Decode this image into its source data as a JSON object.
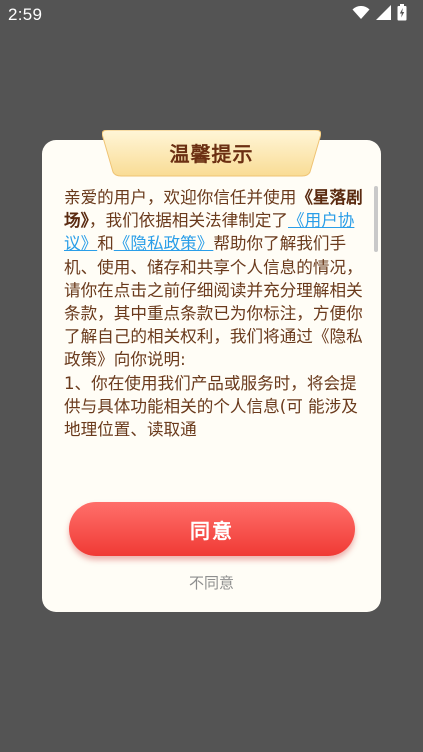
{
  "status_bar": {
    "time": "2:59"
  },
  "dialog": {
    "title": "温馨提示",
    "body": {
      "p1": "亲爱的用户，欢迎你信任并使用",
      "app_name": "《星落剧场》",
      "p2": "，我们依据相关法律制定了",
      "link_user_agreement": "《用户协议》",
      "and": "和",
      "link_privacy_policy": "《隐私政策》",
      "p3": "帮助你了解我们手机、使用、储存和共享个人信息的情况，请你在点击之前仔细阅读并充分理解相关条款，其中重点条款已为你标注，方便你了解自己的相关权利，我们将通过《隐私政策》向你说明:",
      "p4": " 1、你在使用我们产品或服务时，将会提供与具体功能相关的个人信息(可 能涉及地理位置、读取通"
    },
    "agree_label": "同意",
    "disagree_label": "不同意"
  }
}
